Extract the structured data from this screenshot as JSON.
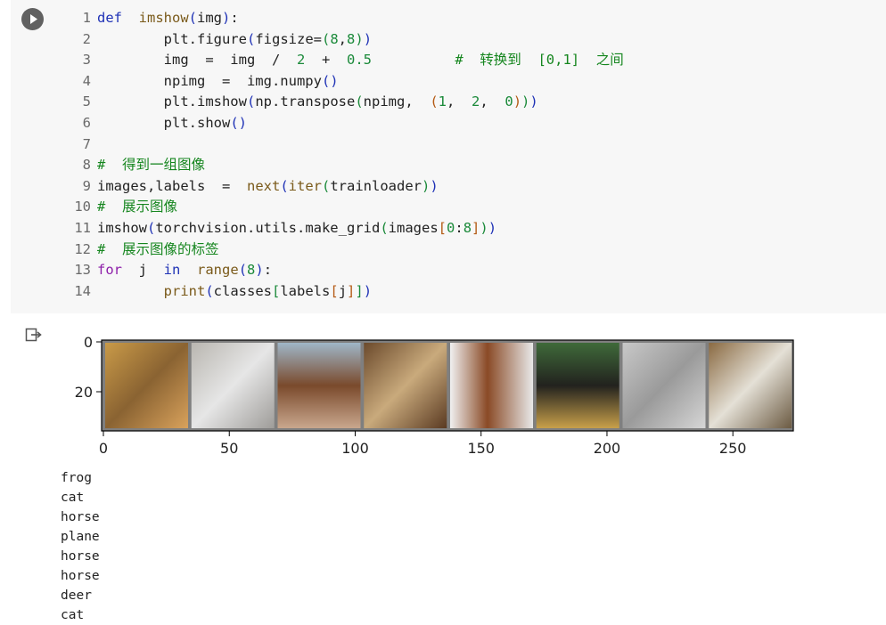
{
  "code_lines": [
    {
      "n": "1",
      "html": "<span class=\"kw\">def</span>  <span class=\"fn\">imshow</span><span class=\"p1\">(</span>img<span class=\"p1\">)</span>:"
    },
    {
      "n": "2",
      "html": "        plt.figure<span class=\"p1\">(</span>figsize=<span class=\"p2\">(</span><span class=\"num\">8</span>,<span class=\"num\">8</span><span class=\"p2\">)</span><span class=\"p1\">)</span>"
    },
    {
      "n": "3",
      "html": "        img  =  img  /  <span class=\"num\">2</span>  +  <span class=\"num\">0.5</span>          <span class=\"cm\">#  转换到  [0,1]  之间</span>"
    },
    {
      "n": "4",
      "html": "        npimg  =  img.numpy<span class=\"p1\">()</span>"
    },
    {
      "n": "5",
      "html": "        plt.imshow<span class=\"p1\">(</span>np.transpose<span class=\"p2\">(</span>npimg,  <span class=\"str\">(</span><span class=\"num\">1</span>,  <span class=\"num\">2</span>,  <span class=\"num\">0</span><span class=\"str\">)</span><span class=\"p2\">)</span><span class=\"p1\">)</span>"
    },
    {
      "n": "6",
      "html": "        plt.show<span class=\"p1\">()</span>"
    },
    {
      "n": "7",
      "html": ""
    },
    {
      "n": "8",
      "html": "<span class=\"cm\">#  得到一组图像</span>"
    },
    {
      "n": "9",
      "html": "images,labels  =  <span class=\"fn\">next</span><span class=\"p1\">(</span><span class=\"fn\">iter</span><span class=\"p2\">(</span>trainloader<span class=\"p2\">)</span><span class=\"p1\">)</span>"
    },
    {
      "n": "10",
      "html": "<span class=\"cm\">#  展示图像</span>"
    },
    {
      "n": "11",
      "html": "imshow<span class=\"p1\">(</span>torchvision.utils.make_grid<span class=\"p2\">(</span>images<span class=\"str\">[</span><span class=\"num\">0</span>:<span class=\"num\">8</span><span class=\"str\">]</span><span class=\"p2\">)</span><span class=\"p1\">)</span>"
    },
    {
      "n": "12",
      "html": "<span class=\"cm\">#  展示图像的标签</span>"
    },
    {
      "n": "13",
      "html": "<span class=\"kw2\">for</span>  j  <span class=\"kw\">in</span>  <span class=\"fn\">range</span><span class=\"p1\">(</span><span class=\"num\">8</span><span class=\"p1\">)</span>:"
    },
    {
      "n": "14",
      "html": "        <span class=\"fn\">print</span><span class=\"p1\">(</span>classes<span class=\"p2\">[</span>labels<span class=\"str\">[</span>j<span class=\"str\">]</span><span class=\"p2\">]</span><span class=\"p1\">)</span>"
    }
  ],
  "plot": {
    "x_ticks": [
      "0",
      "50",
      "100",
      "150",
      "200",
      "250"
    ],
    "y_ticks": [
      "0",
      "20"
    ],
    "images": [
      "frog",
      "cat",
      "horse",
      "plane",
      "horse",
      "horse",
      "deer",
      "cat"
    ]
  },
  "output_lines": [
    "frog",
    "cat",
    "horse",
    "plane",
    "horse",
    "horse",
    "deer",
    "cat"
  ],
  "icons": {
    "run": "play-icon",
    "output": "output-arrow-icon"
  }
}
